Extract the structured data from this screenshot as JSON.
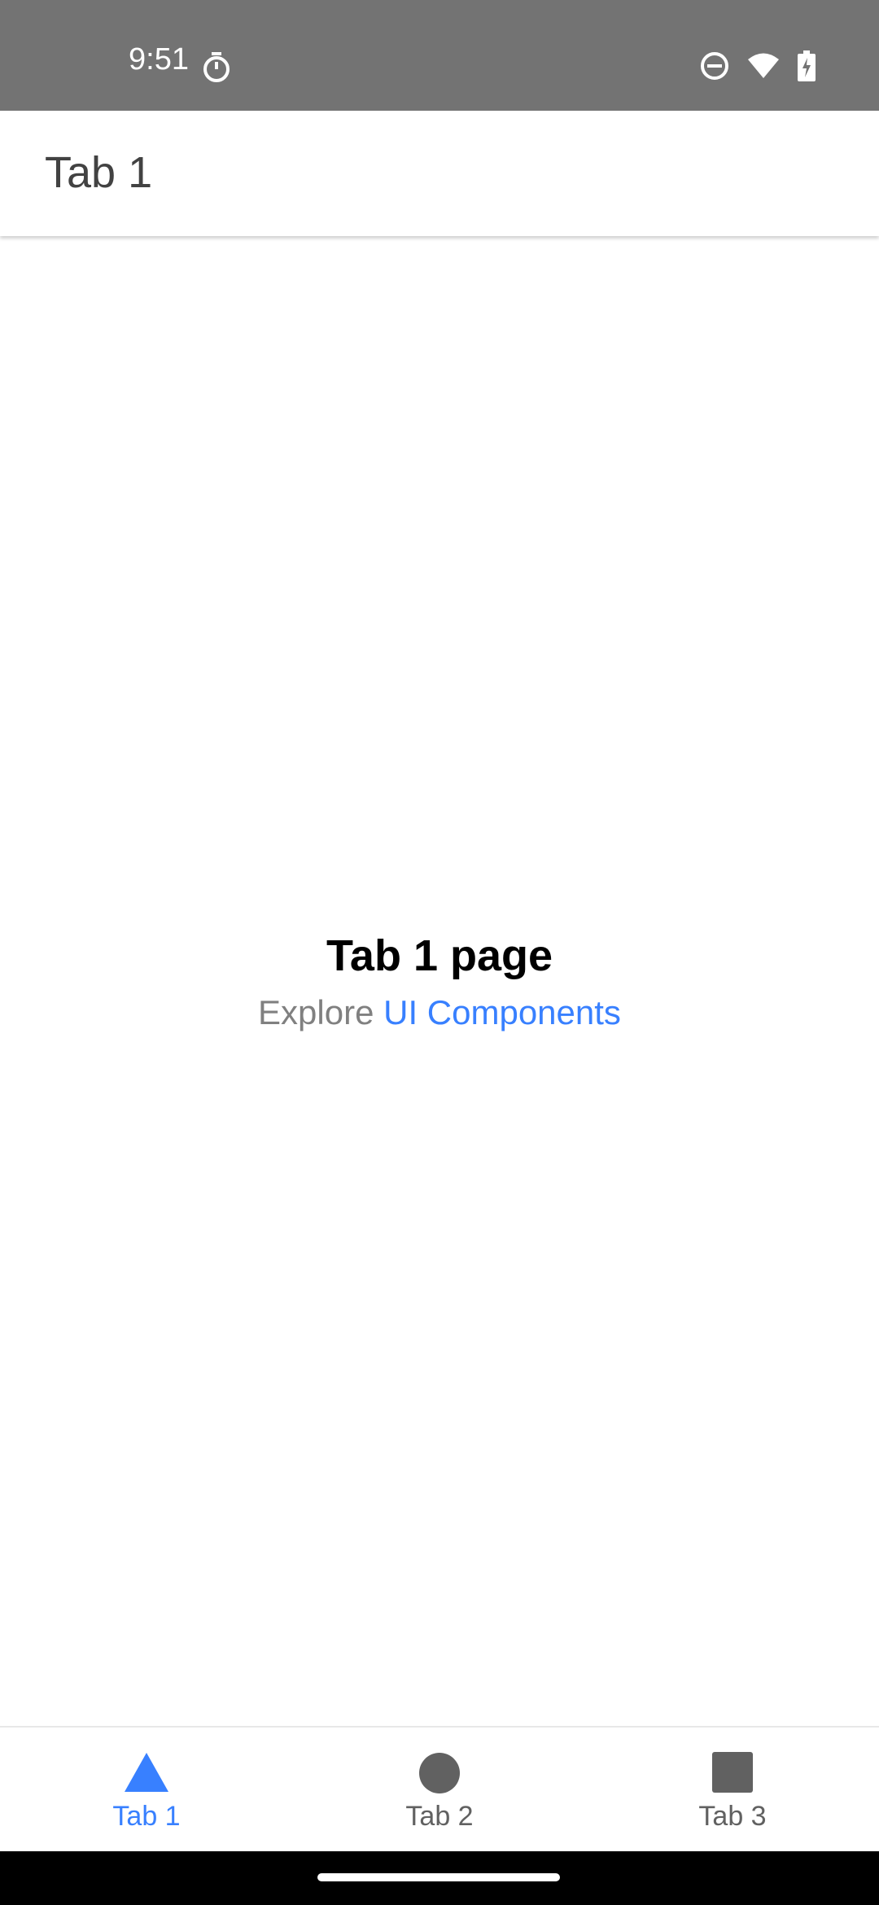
{
  "status_bar": {
    "time": "9:51",
    "icons": [
      "timer-icon",
      "do-not-disturb-icon",
      "wifi-icon",
      "battery-charging-icon"
    ]
  },
  "app_bar": {
    "title": "Tab 1"
  },
  "main": {
    "heading": "Tab 1 page",
    "explore_text": "Explore",
    "explore_link": "UI Components"
  },
  "tab_bar": {
    "tabs": [
      {
        "label": "Tab 1",
        "icon": "triangle-icon",
        "selected": true
      },
      {
        "label": "Tab 2",
        "icon": "circle-icon",
        "selected": false
      },
      {
        "label": "Tab 3",
        "icon": "square-icon",
        "selected": false
      }
    ]
  },
  "colors": {
    "accent": "#3880ff",
    "status_bar": "#737373",
    "icon_inactive": "#616161"
  }
}
